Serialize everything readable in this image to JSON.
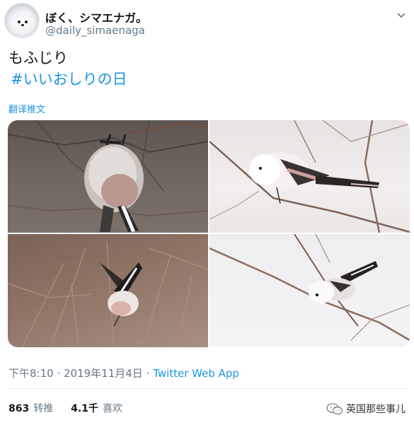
{
  "user": {
    "display_name": "ぼく、シマエナガ。",
    "handle": "@daily_simaenaga"
  },
  "tweet": {
    "text": "もふじり",
    "hashtag": "#いいおしりの日",
    "translate_label": "翻译推文"
  },
  "photos": [
    {
      "icon": "bird-photo-1"
    },
    {
      "icon": "bird-photo-2"
    },
    {
      "icon": "bird-photo-3"
    },
    {
      "icon": "bird-photo-4"
    }
  ],
  "meta": {
    "time": "下午8:10 · 2019年11月4日 · ",
    "source": "Twitter Web App"
  },
  "stats": {
    "retweets": "863",
    "retweets_label": "转推",
    "likes": "4.1千",
    "likes_label": "喜欢"
  },
  "watermark": {
    "text": "英国那些事儿"
  },
  "colors": {
    "link": "#1b95e0",
    "secondary": "#657786",
    "primary": "#14171a"
  }
}
